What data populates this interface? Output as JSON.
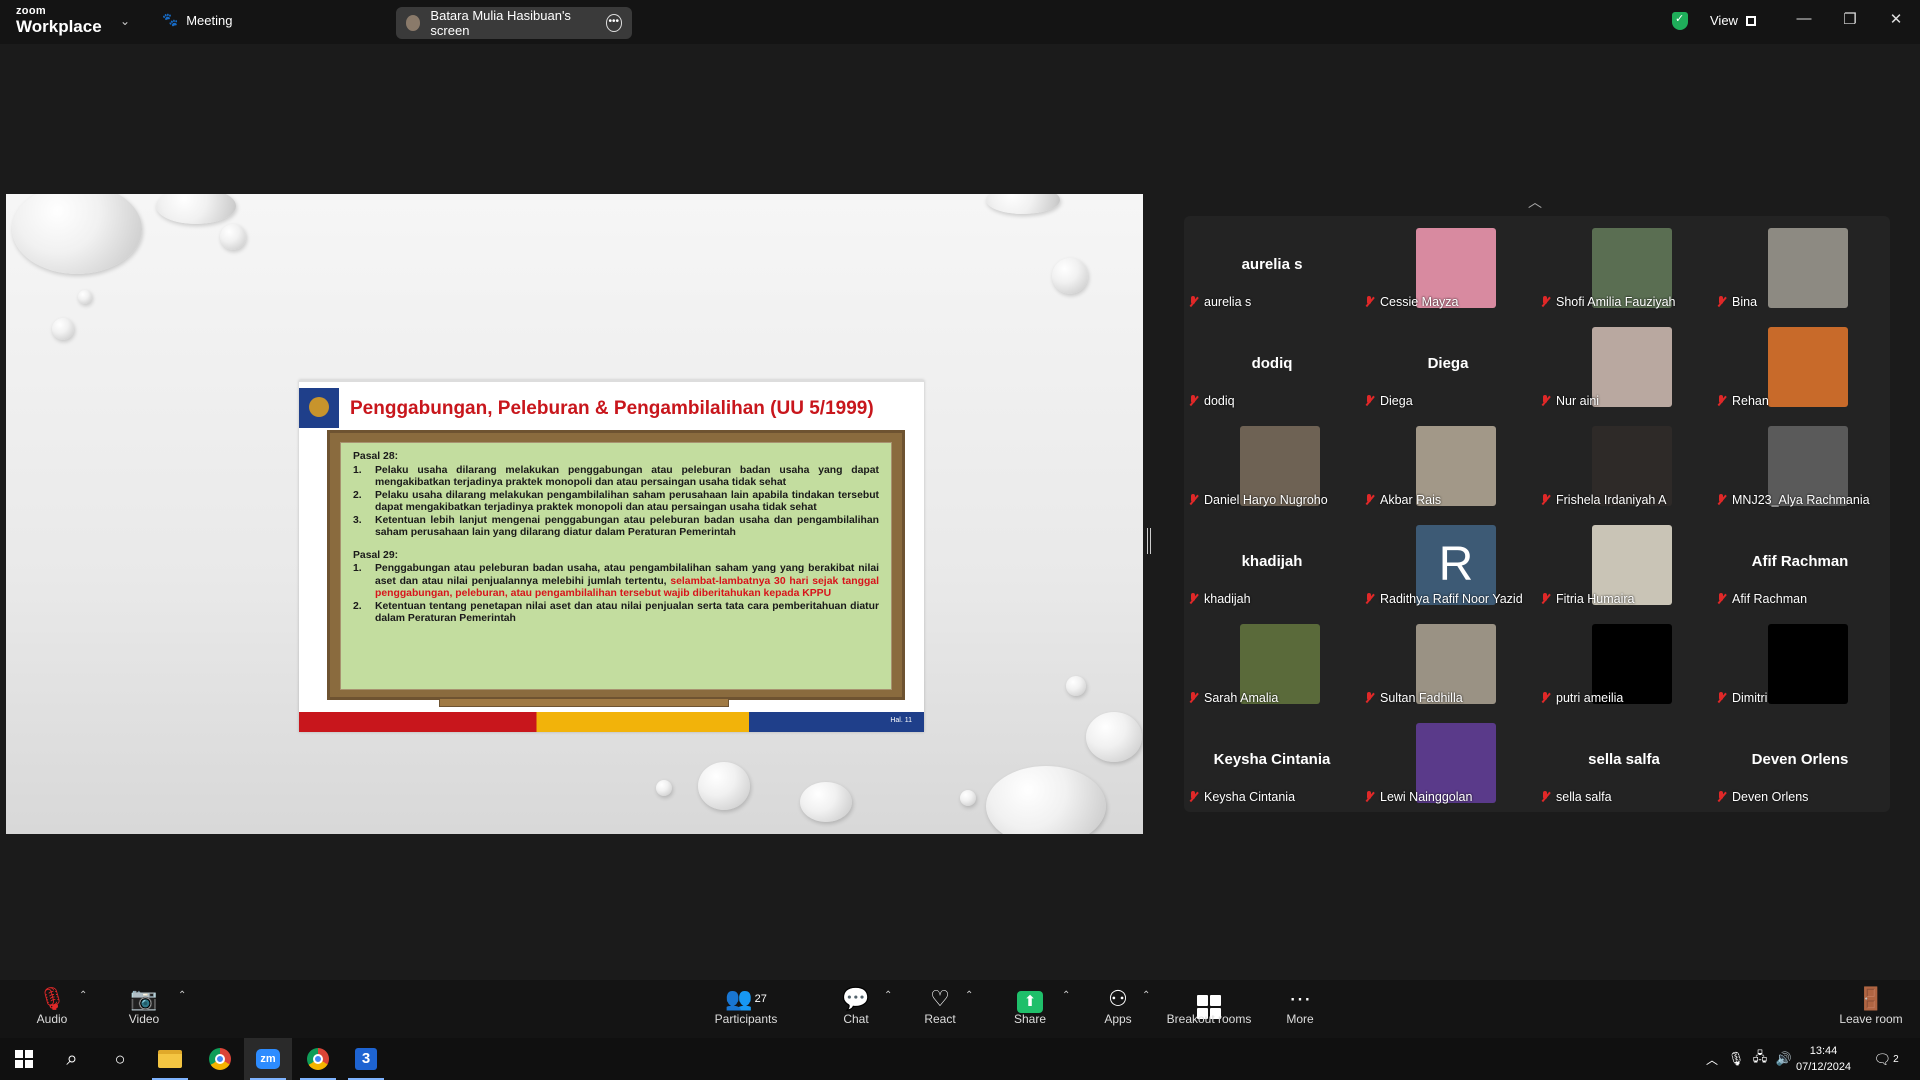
{
  "app": {
    "brand_top": "zoom",
    "brand_bottom": "Workplace",
    "meeting_label": "Meeting",
    "share_pill_label": "Batara Mulia Hasibuan's screen",
    "view_label": "View"
  },
  "slide": {
    "title": "Penggabungan, Peleburan & Pengambilalihan (UU 5/1999)",
    "pasal28": "Pasal 28:",
    "p28_items": [
      {
        "n": "1.",
        "t": "Pelaku usaha dilarang melakukan penggabungan atau peleburan badan usaha yang dapat mengakibatkan terjadinya praktek monopoli dan atau persaingan usaha tidak sehat"
      },
      {
        "n": "2.",
        "t": "Pelaku usaha dilarang melakukan pengambilalihan saham perusahaan lain apabila tindakan tersebut dapat mengakibatkan terjadinya praktek monopoli dan atau persaingan usaha tidak sehat"
      },
      {
        "n": "3.",
        "t": "Ketentuan lebih lanjut mengenai penggabungan atau peleburan badan usaha dan pengambilalihan saham perusahaan lain yang dilarang diatur dalam Peraturan Pemerintah"
      }
    ],
    "pasal29": "Pasal 29:",
    "p29_item1_n": "1.",
    "p29_item1_black": "Penggabungan atau peleburan badan usaha, atau pengambilalihan saham yang yang berakibat nilai aset dan atau nilai penjualannya melebihi jumlah tertentu, ",
    "p29_item1_red": "selambat-lambatnya 30 hari sejak tanggal penggabungan, peleburan, atau pengambilalihan tersebut wajib diberitahukan kepada KPPU",
    "p29_item2_n": "2.",
    "p29_item2": "Ketentuan tentang penetapan nilai aset dan atau nilai penjualan serta tata cara pemberitahuan diatur dalam Peraturan Pemerintah",
    "page_label": "Hal. 11"
  },
  "participants": [
    {
      "name": "aurelia s",
      "big": "aurelia s",
      "color": ""
    },
    {
      "name": "Cessie Mayza",
      "big": "",
      "color": "#d88aa0"
    },
    {
      "name": "Shofi Amilia Fauziyah",
      "big": "",
      "color": "#5a6e52"
    },
    {
      "name": "Bina",
      "big": "",
      "color": "#8d8a82"
    },
    {
      "name": "dodiq",
      "big": "dodiq",
      "color": ""
    },
    {
      "name": "Diega",
      "big": "Diega",
      "color": ""
    },
    {
      "name": "Nur aini",
      "big": "",
      "color": "#b9a8a0"
    },
    {
      "name": "Rehan",
      "big": "",
      "color": "#c86a2a"
    },
    {
      "name": "Daniel Haryo Nugroho",
      "big": "",
      "color": "#6e6254"
    },
    {
      "name": "Akbar Rais",
      "big": "",
      "color": "#a29888"
    },
    {
      "name": "Frishela Irdaniyah A",
      "big": "",
      "color": "#2e2a28"
    },
    {
      "name": "MNJ23_Alya Rachmania",
      "big": "",
      "color": "#5a5a5a"
    },
    {
      "name": "khadijah",
      "big": "khadijah",
      "color": ""
    },
    {
      "name": "Radithya Rafif Noor Yazid",
      "big": "",
      "color": "#3d5a75",
      "letter": "R"
    },
    {
      "name": "Fitria Humaira",
      "big": "",
      "color": "#c9c4b6"
    },
    {
      "name": "Afif Rachman",
      "big": "Afif Rachman",
      "color": ""
    },
    {
      "name": "Sarah Amalia",
      "big": "",
      "color": "#5a6a3a"
    },
    {
      "name": "Sultan Fadhilla",
      "big": "",
      "color": "#9a9284"
    },
    {
      "name": "putri ameilia",
      "big": "",
      "color": "#000000"
    },
    {
      "name": "Dimitri",
      "big": "",
      "color": "#000000"
    },
    {
      "name": "Keysha Cintania",
      "big": "Keysha Cintania",
      "color": ""
    },
    {
      "name": "Lewi Nainggolan",
      "big": "",
      "color": "#5a3a8a"
    },
    {
      "name": "sella salfa",
      "big": "sella salfa",
      "color": ""
    },
    {
      "name": "Deven Orlens",
      "big": "Deven Orlens",
      "color": ""
    }
  ],
  "toolbar": {
    "audio": "Audio",
    "video": "Video",
    "participants": "Participants",
    "participants_count": "27",
    "chat": "Chat",
    "react": "React",
    "share": "Share",
    "apps": "Apps",
    "breakout": "Breakout rooms",
    "more": "More",
    "leave": "Leave room"
  },
  "taskbar": {
    "time": "13:44",
    "date": "07/12/2024",
    "notif_count": "2"
  }
}
